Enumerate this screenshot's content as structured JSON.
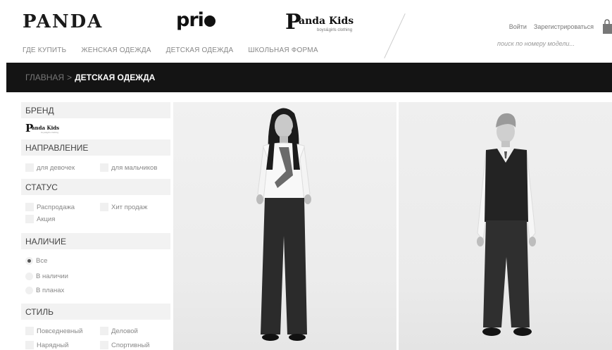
{
  "header": {
    "logo_panda": "PANDA",
    "logo_prio": "pri",
    "logo_kids": "anda Kids",
    "logo_kids_sub": "boys&girls clothing",
    "nav": [
      "ГДЕ КУПИТЬ",
      "ЖЕНСКАЯ ОДЕЖДА",
      "ДЕТСКАЯ ОДЕЖДА",
      "ШКОЛЬНАЯ ФОРМА"
    ],
    "login": "Войти",
    "register": "Зарегистрироваться",
    "search_placeholder": "поиск по номеру модели..."
  },
  "breadcrumb": {
    "home": "ГЛАВНАЯ",
    "separator": ">",
    "current": "ДЕТСКАЯ ОДЕЖДА"
  },
  "sidebar": {
    "brand": {
      "title": "БРЕНД",
      "logo_text": "anda Kids",
      "logo_sub": "boys&girls clothing"
    },
    "direction": {
      "title": "НАПРАВЛЕНИЕ",
      "options": [
        "для девочек",
        "для мальчиков"
      ]
    },
    "status": {
      "title": "СТАТУС",
      "options": [
        "Распродажа",
        "Хит продаж",
        "Акция"
      ]
    },
    "availability": {
      "title": "НАЛИЧИЕ",
      "options": [
        "Все",
        "В наличии",
        "В планах"
      ],
      "selected": "Все"
    },
    "style": {
      "title": "СТИЛЬ",
      "options": [
        "Повседневный",
        "Деловой",
        "Нарядный",
        "Спортивный"
      ]
    }
  },
  "products": [
    {
      "image": "girl-school-uniform-photo"
    },
    {
      "image": "boy-school-uniform-photo"
    }
  ],
  "colors": {
    "breadcrumb_bg": "#141414",
    "section_bg": "#f2f2f2"
  }
}
